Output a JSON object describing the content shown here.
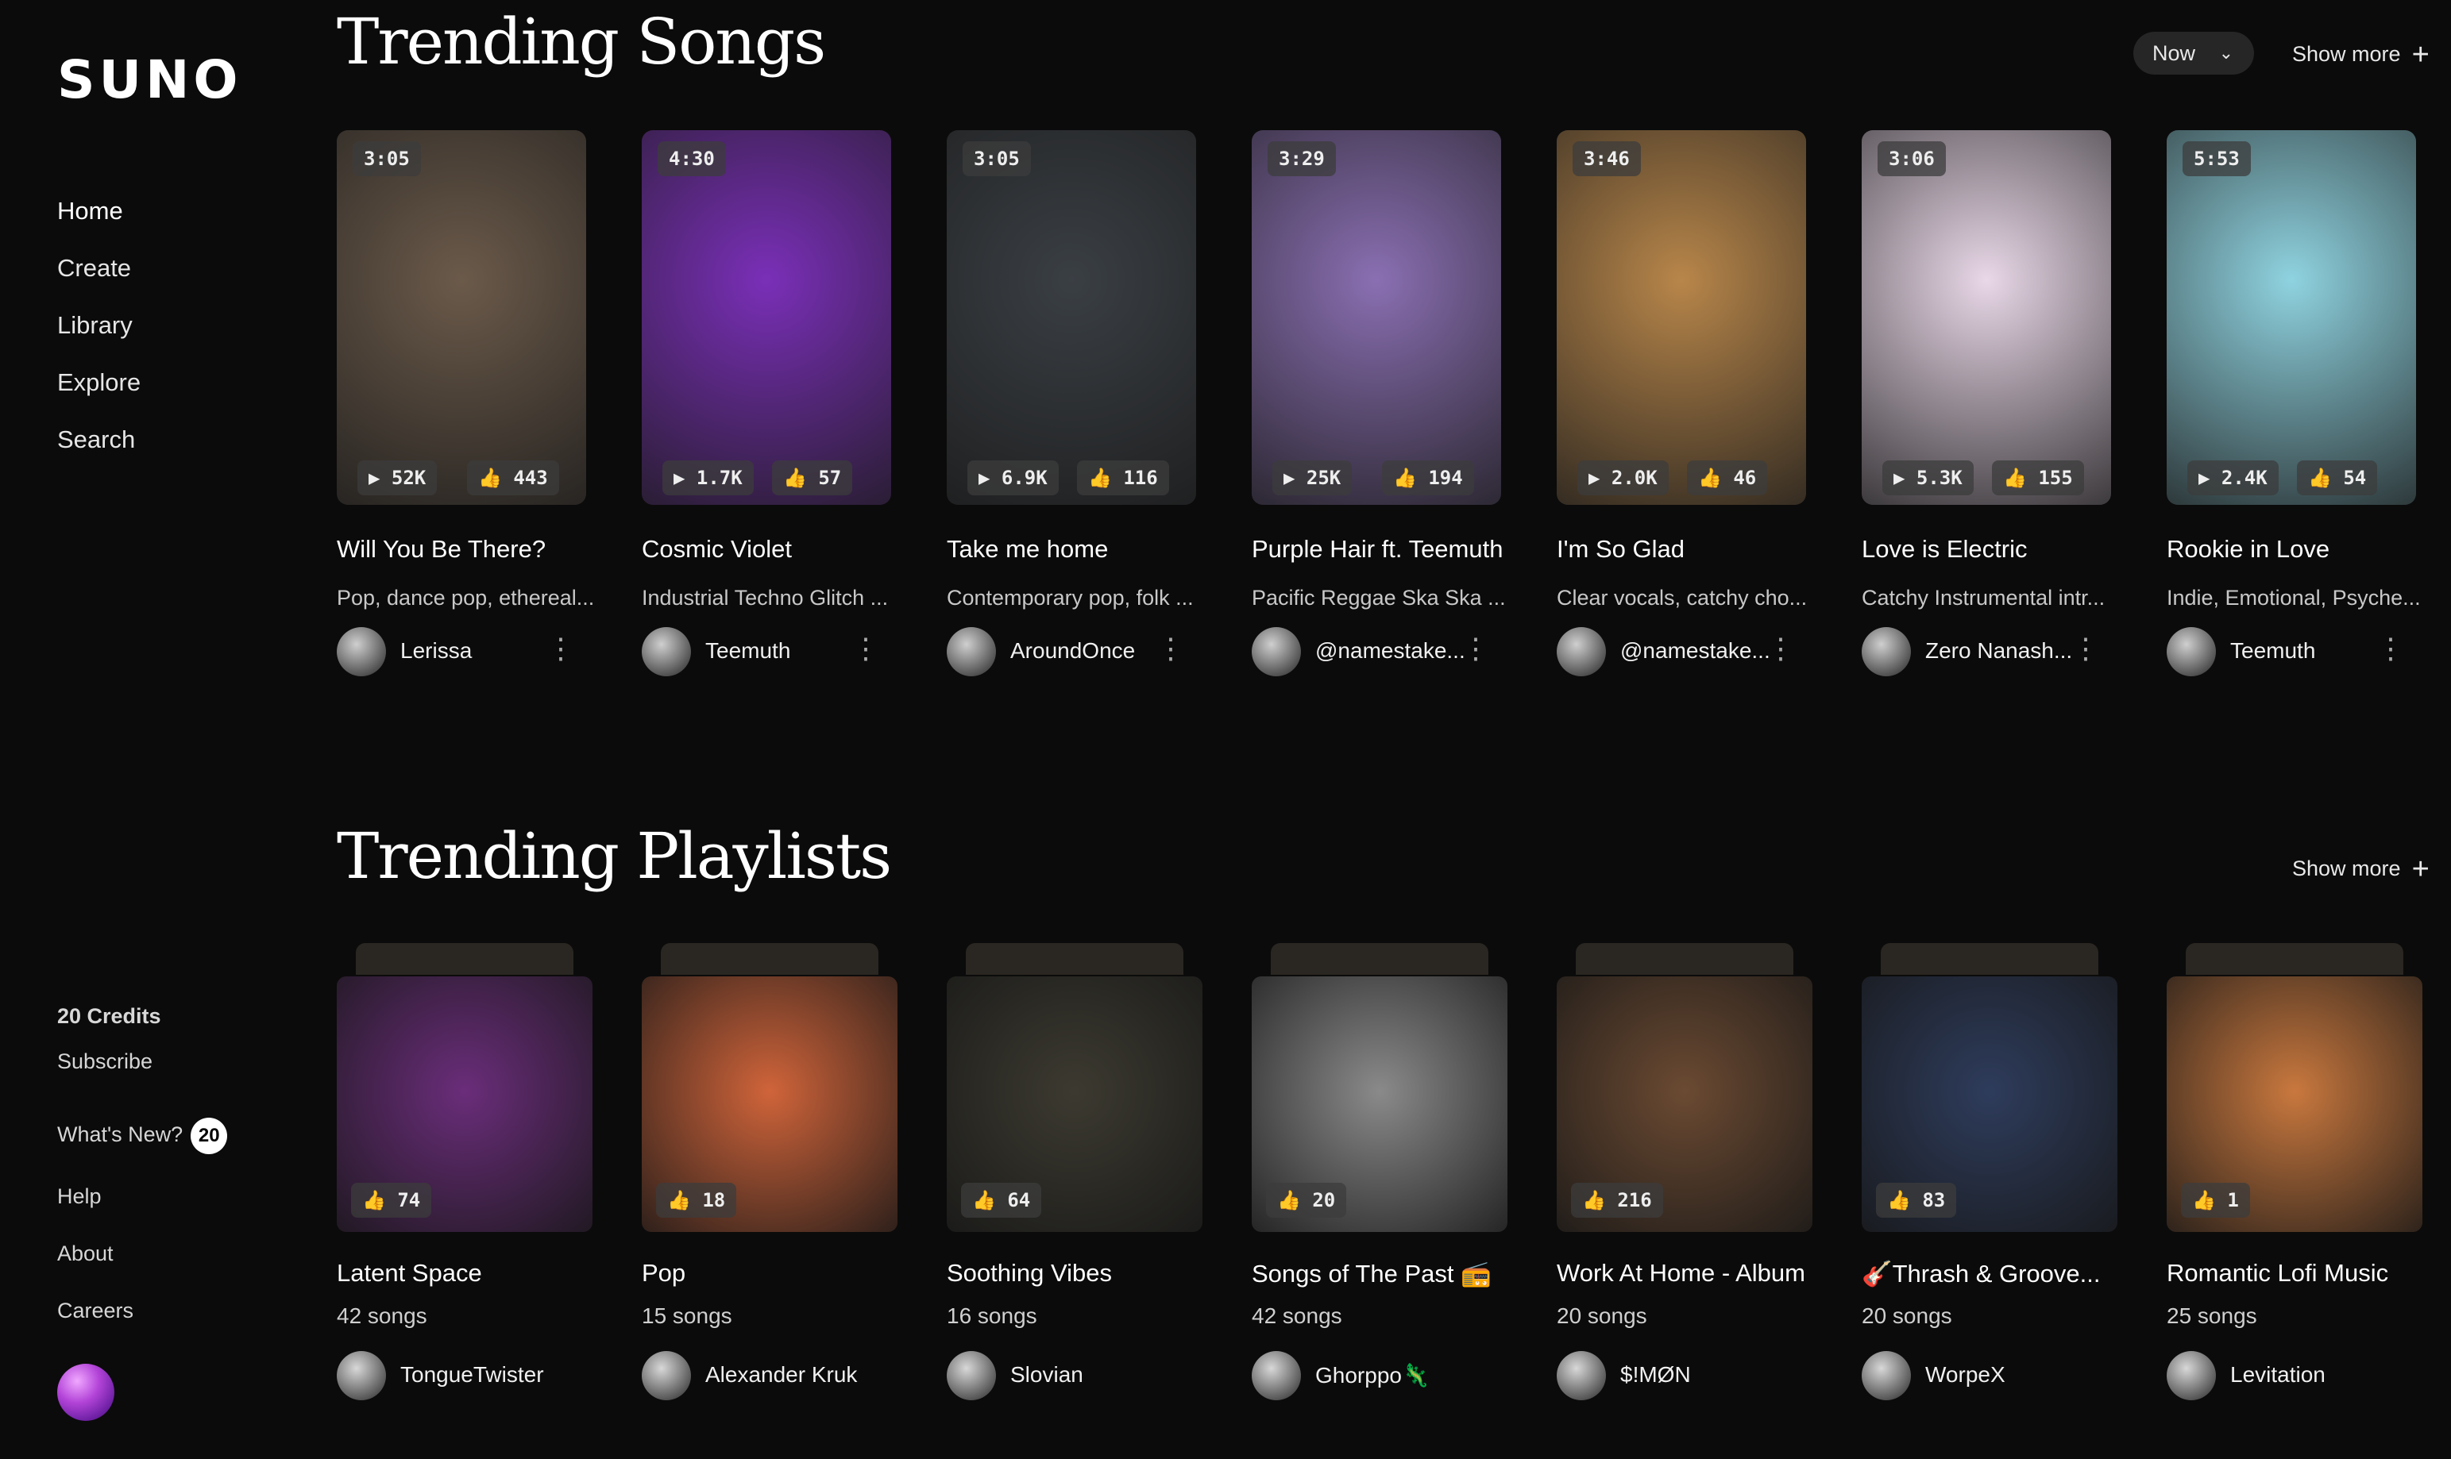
{
  "app": {
    "logo": "SUNO"
  },
  "sidebar": {
    "nav": [
      {
        "label": "Home"
      },
      {
        "label": "Create"
      },
      {
        "label": "Library"
      },
      {
        "label": "Explore"
      },
      {
        "label": "Search"
      }
    ],
    "credits": "20 Credits",
    "subscribe": "Subscribe",
    "whats_new": "What's New?",
    "whats_new_count": "20",
    "help": "Help",
    "about": "About",
    "careers": "Careers"
  },
  "trending_songs": {
    "title": "Trending Songs",
    "time_filter": "Now",
    "show_more": "Show more",
    "songs": [
      {
        "duration": "3:05",
        "plays": "52K",
        "likes": "443",
        "title": "Will You Be There?",
        "desc": "Pop, dance pop, ethereal...",
        "author": "Lerissa",
        "art_color": "#6b5a4a"
      },
      {
        "duration": "4:30",
        "plays": "1.7K",
        "likes": "57",
        "title": "Cosmic Violet",
        "desc": "Industrial Techno Glitch ...",
        "author": "Teemuth",
        "art_color": "#7a2fb8"
      },
      {
        "duration": "3:05",
        "plays": "6.9K",
        "likes": "116",
        "title": "Take me home",
        "desc": "Contemporary pop, folk ...",
        "author": "AroundOnce",
        "art_color": "#3a3f44"
      },
      {
        "duration": "3:29",
        "plays": "25K",
        "likes": "194",
        "title": "Purple Hair ft. Teemuth",
        "desc": "Pacific Reggae Ska Ska ...",
        "author": "@namestake...",
        "art_color": "#8a6fb2"
      },
      {
        "duration": "3:46",
        "plays": "2.0K",
        "likes": "46",
        "title": "I'm So Glad",
        "desc": "Clear vocals, catchy cho...",
        "author": "@namestake...",
        "art_color": "#b8864a"
      },
      {
        "duration": "3:06",
        "plays": "5.3K",
        "likes": "155",
        "title": "Love is Electric",
        "desc": "Catchy Instrumental intr...",
        "author": "Zero Nanash...",
        "art_color": "#e9d8e8"
      },
      {
        "duration": "5:53",
        "plays": "2.4K",
        "likes": "54",
        "title": "Rookie in Love",
        "desc": "Indie, Emotional, Psyche...",
        "author": "Teemuth",
        "art_color": "#8fd3e0"
      }
    ]
  },
  "trending_playlists": {
    "title": "Trending Playlists",
    "show_more": "Show more",
    "playlists": [
      {
        "likes": "74",
        "title": "Latent Space",
        "count": "42 songs",
        "author": "TongueTwister",
        "art_color": "#6a2d7a"
      },
      {
        "likes": "18",
        "title": "Pop",
        "count": "15 songs",
        "author": "Alexander Kruk",
        "art_color": "#d0643a"
      },
      {
        "likes": "64",
        "title": "Soothing Vibes",
        "count": "16 songs",
        "author": "Slovian",
        "art_color": "#3c3a30"
      },
      {
        "likes": "20",
        "title": "Songs of The Past 📻",
        "count": "42 songs",
        "author": "Ghorppo🦎",
        "art_color": "#8a8a8a"
      },
      {
        "likes": "216",
        "title": "Work At Home - Album",
        "count": "20 songs",
        "author": "$!MØN",
        "art_color": "#6b4a32"
      },
      {
        "likes": "83",
        "title": "🎸Thrash & Groove...",
        "count": "20 songs",
        "author": "WorpeX",
        "art_color": "#2e3c5c"
      },
      {
        "likes": "1",
        "title": "Romantic Lofi Music",
        "count": "25 songs",
        "author": "Levitation",
        "art_color": "#c9783e"
      }
    ]
  }
}
